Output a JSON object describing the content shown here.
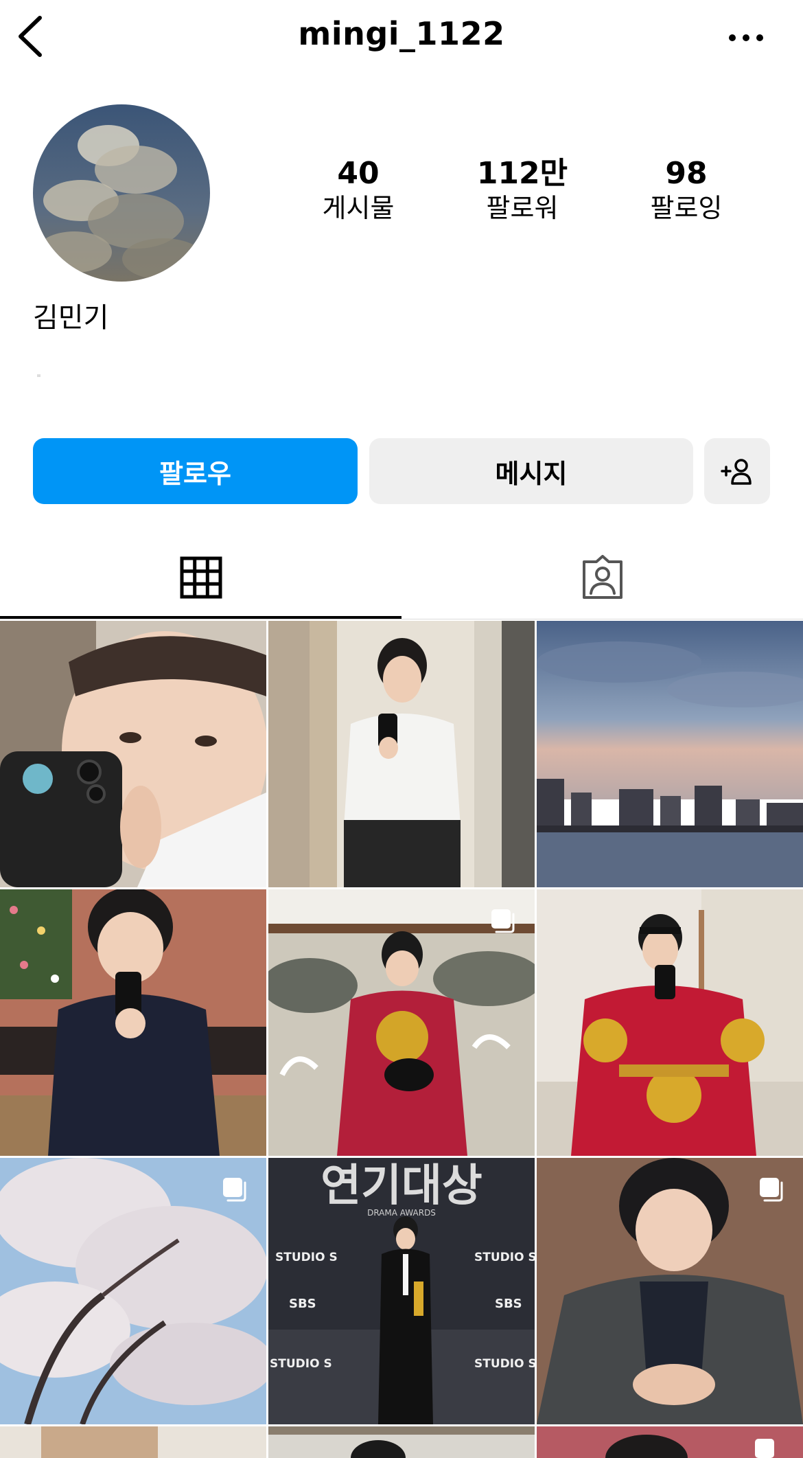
{
  "header": {
    "username": "mingi_1122",
    "back_icon": "chevron-left-icon",
    "more_icon": "more-horizontal-icon"
  },
  "profile": {
    "full_name": "김민기",
    "stats": {
      "posts": {
        "count": "40",
        "label": "게시물"
      },
      "followers": {
        "count": "112만",
        "label": "팔로워"
      },
      "following": {
        "count": "98",
        "label": "팔로잉"
      }
    }
  },
  "actions": {
    "follow_label": "팔로우",
    "message_label": "메시지",
    "suggest_icon": "add-person-icon",
    "follow_color": "#0095f6"
  },
  "tabs": [
    {
      "name": "posts-grid",
      "icon": "grid-icon",
      "active": true
    },
    {
      "name": "tagged",
      "icon": "tagged-person-icon",
      "active": false
    }
  ],
  "posts": [
    {
      "subject": "mirror-selfie-hat",
      "multi": false
    },
    {
      "subject": "mirror-selfie-white-polo",
      "multi": false
    },
    {
      "subject": "city-river-skyline",
      "multi": false
    },
    {
      "subject": "mirror-selfie-navy-polo",
      "multi": false
    },
    {
      "subject": "hanbok-folding-screen",
      "multi": true
    },
    {
      "subject": "hanbok-mirror-selfie",
      "multi": false
    },
    {
      "subject": "cherry-blossoms",
      "multi": true
    },
    {
      "subject": "drama-awards",
      "multi": false,
      "sign_text": "연기대상",
      "sign_sub": "DRAMA AWARDS",
      "logos": [
        "STUDIO S",
        "SBS",
        "STUDIO S",
        "SBS",
        "STUDIO S",
        "STUDIO S"
      ]
    },
    {
      "subject": "hoodie-portrait",
      "multi": true
    }
  ]
}
